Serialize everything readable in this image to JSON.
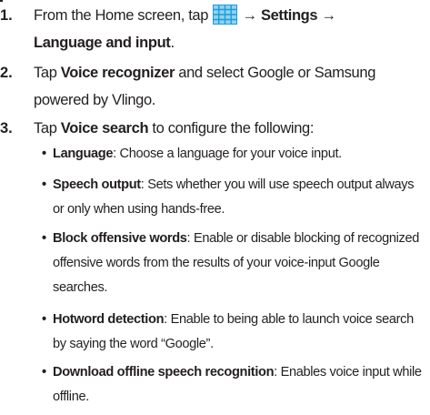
{
  "steps": [
    {
      "number": "1.",
      "t1": "From the Home screen, tap",
      "icon": "apps-grid-icon",
      "t2": "→",
      "settings": "Settings",
      "t3": "→",
      "language_and_input": "Language and input",
      "t4": "."
    },
    {
      "number": "2.",
      "t1": "Tap",
      "voice_recognizer": "Voice recognizer",
      "t2": "and select Google or Samsung powered by Vlingo."
    },
    {
      "number": "3.",
      "t1": "Tap",
      "voice_search": "Voice search",
      "t2": "to configure the following:"
    }
  ],
  "bullets": [
    {
      "dot": "•",
      "term": "Language",
      "desc": ": Choose a language for your voice input."
    },
    {
      "dot": "•",
      "term": "Speech output",
      "desc": ": Sets whether you will use speech output always or only when using hands-free."
    },
    {
      "dot": "•",
      "term": "Block offensive words",
      "desc": ": Enable or disable blocking of recognized offensive words from the results of your voice-input Google searches."
    },
    {
      "dot": "•",
      "term": "Hotword detection",
      "desc": ": Enable to being able to launch voice search by saying the word “Google”."
    },
    {
      "dot": "•",
      "term": "Download offline speech recognition",
      "desc": ": Enables voice input while offline."
    }
  ],
  "colors": {
    "text": "#231f20",
    "icon_fill": "#8fd3f2",
    "icon_lines": "#1f9bd6"
  }
}
